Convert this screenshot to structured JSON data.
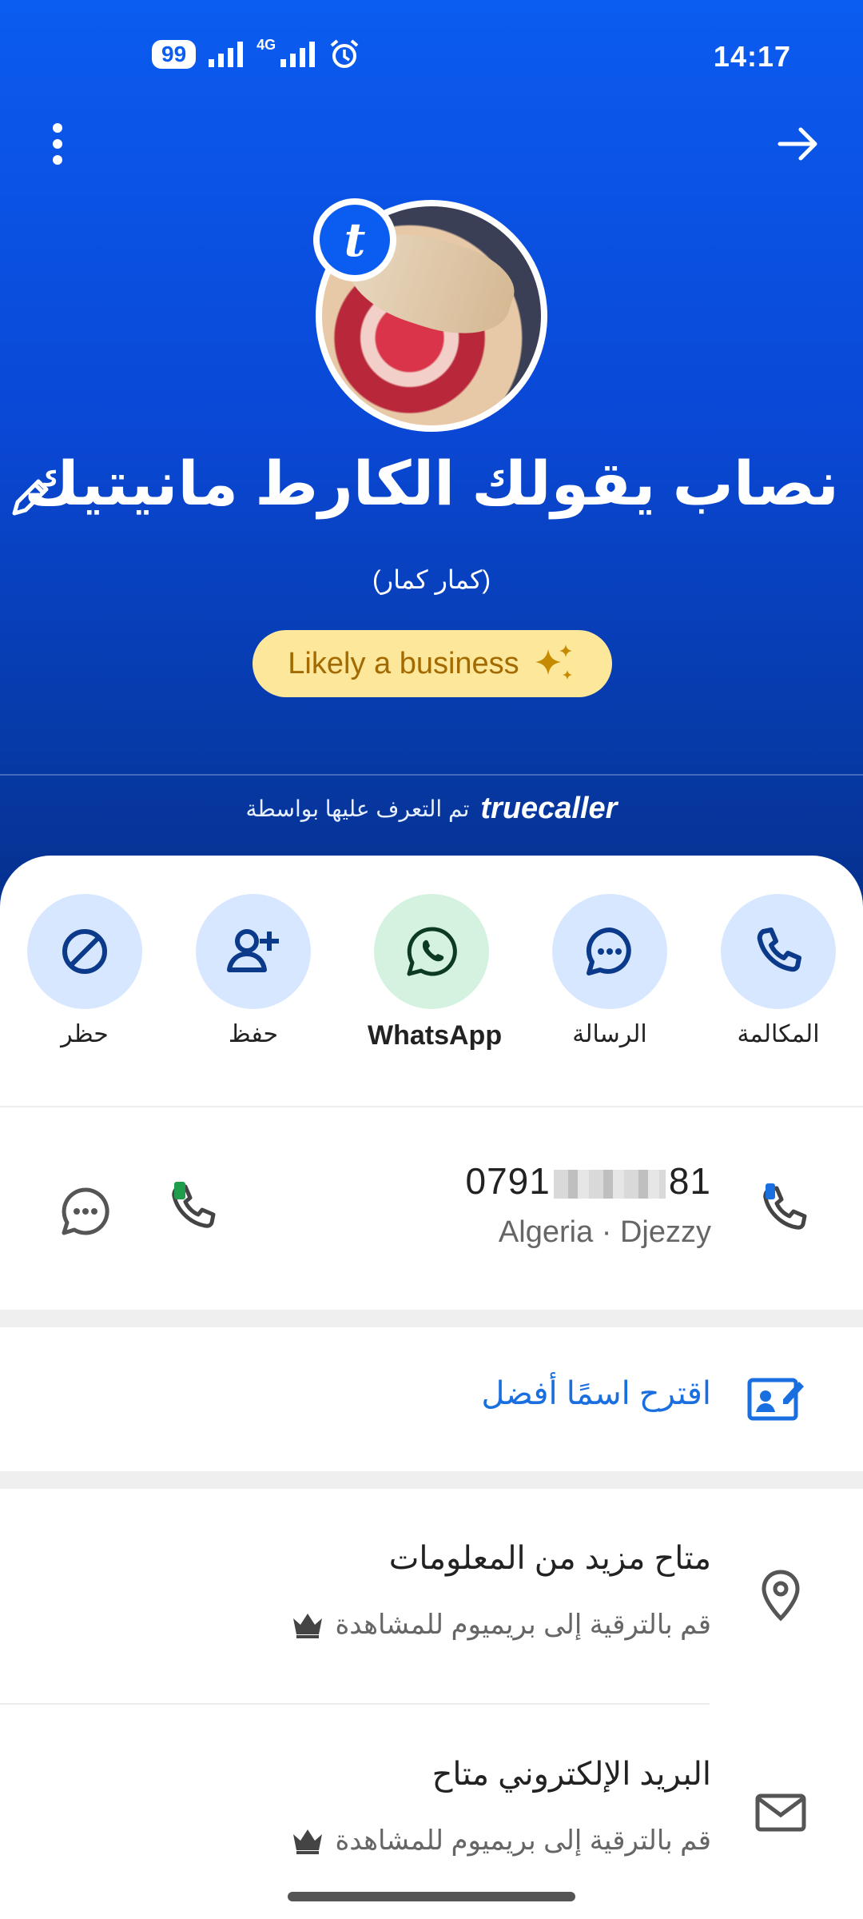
{
  "status_bar": {
    "time": "14:17",
    "badge": "99",
    "network": "4G"
  },
  "contact": {
    "name": "نصاب يقولك الكارط مانيتيك",
    "subname": "(كمار كمار)",
    "tag": "Likely a business"
  },
  "identified_by": {
    "text": "تم التعرف عليها بواسطة",
    "brand": "truecaller"
  },
  "actions": [
    {
      "label": "حظر",
      "icon": "block-icon"
    },
    {
      "label": "حفظ",
      "icon": "add-contact-icon"
    },
    {
      "label": "WhatsApp",
      "icon": "whatsapp-icon"
    },
    {
      "label": "الرسالة",
      "icon": "message-icon"
    },
    {
      "label": "المكالمة",
      "icon": "phone-icon"
    }
  ],
  "phone": {
    "number_start": "0791",
    "number_end": "81",
    "carrier": "Algeria · Djezzy"
  },
  "suggest": {
    "label": "اقترح اسمًا أفضل"
  },
  "info": [
    {
      "title": "متاح مزيد من المعلومات",
      "sub": "قم بالترقية إلى بريميوم للمشاهدة",
      "icon": "location-pin-icon"
    },
    {
      "title": "البريد الإلكتروني متاح",
      "sub": "قم بالترقية إلى بريميوم للمشاهدة",
      "icon": "mail-icon"
    }
  ],
  "colors": {
    "primary": "#0b5cf0",
    "badge_bg": "#fde79a",
    "badge_text": "#a26a00",
    "action_bg": "#d7e7ff",
    "whatsapp_bg": "#d5f2e0",
    "link": "#1a6fe0"
  }
}
